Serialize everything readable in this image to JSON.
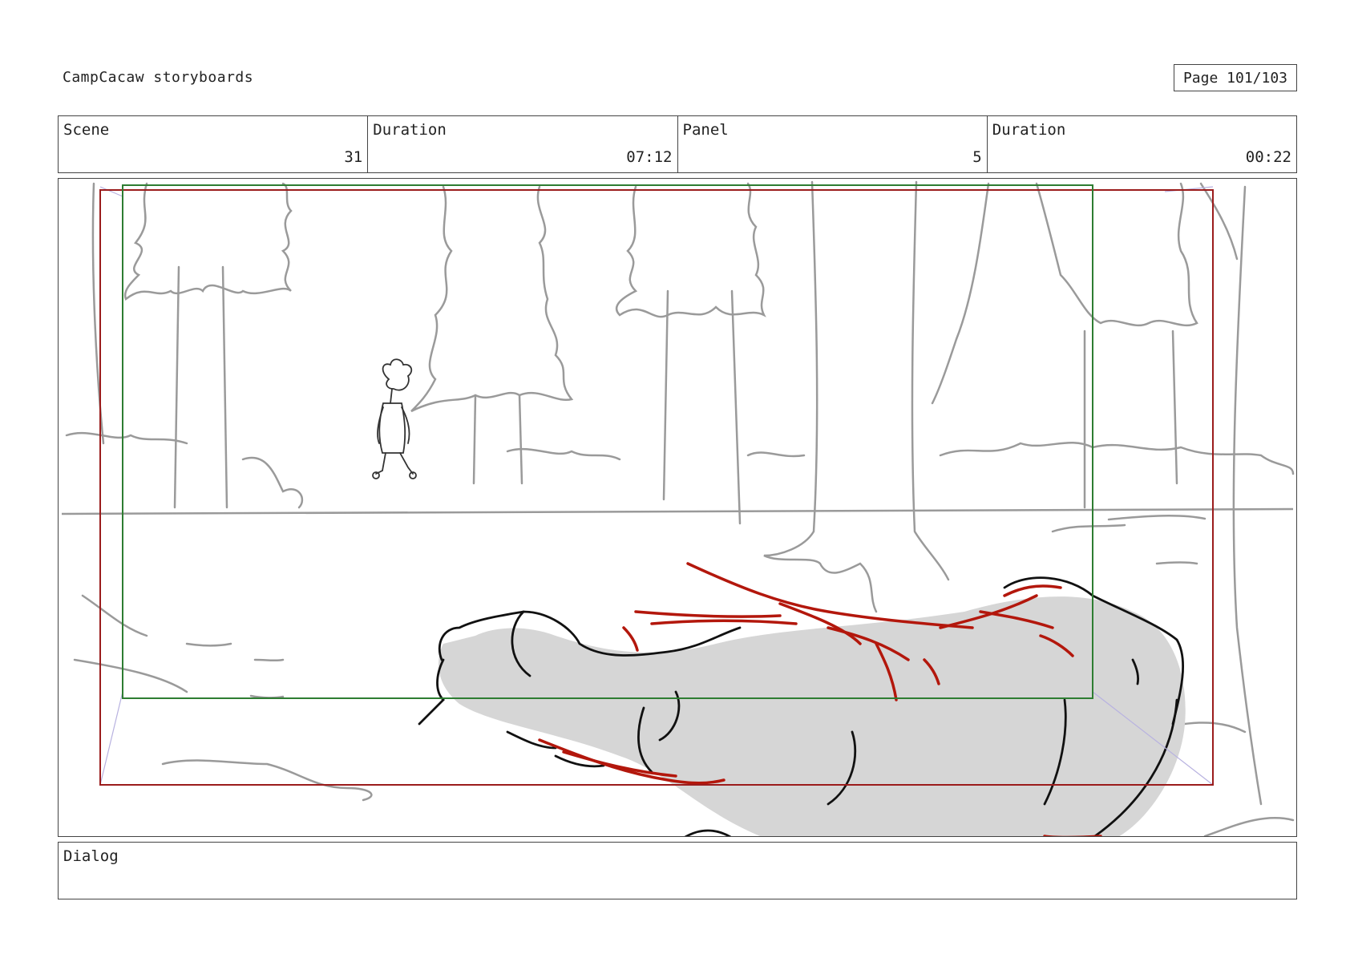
{
  "header": {
    "project_title": "CampCacaw storyboards",
    "page_label": "Page 101/103"
  },
  "info_bar": {
    "scene_label": "Scene",
    "scene_value": "31",
    "scene_duration_label": "Duration",
    "scene_duration_value": "07:12",
    "panel_label": "Panel",
    "panel_value": "5",
    "panel_duration_label": "Duration",
    "panel_duration_value": "00:22"
  },
  "panel": {
    "description_icons": [
      "forest-trees",
      "walking-kid",
      "fallen-body"
    ],
    "colors": {
      "sketch_gray": "#9a9a9a",
      "ink_black": "#111111",
      "blood_red": "#b3170c",
      "safe_frame_green": "#2e7d32",
      "action_frame_red": "#9b1c1c",
      "body_fill": "#d6d6d6"
    }
  },
  "dialog": {
    "label": "Dialog",
    "text": ""
  }
}
